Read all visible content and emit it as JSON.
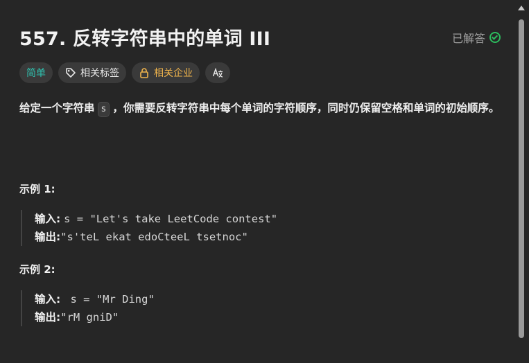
{
  "problem": {
    "title": "557. 反转字符串中的单词 III",
    "status": "已解答"
  },
  "tags": {
    "difficulty": "简单",
    "related_topics": "相关标签",
    "companies": "相关企业",
    "font_toggle": "A文"
  },
  "description": {
    "part1": "给定一个字符串",
    "code": "s",
    "part2": "，你需要反转字符串中每个单词的字符顺序，同时仍保留空格和单词的初始顺序。"
  },
  "examples": [
    {
      "title": "示例 1:",
      "input_label": "输入:",
      "input_value": "s = \"Let's take LeetCode contest\"",
      "output_label": "输出:",
      "output_value": "\"s'teL ekat edoCteeL tsetnoc\""
    },
    {
      "title": "示例 2:",
      "input_label": "输入:",
      "input_value": " s = \"Mr Ding\"",
      "output_label": "输出:",
      "output_value": "\"rM gniD\""
    }
  ],
  "colors": {
    "background": "#262626",
    "easy": "#2fc4b2",
    "company": "#f0b44c",
    "solved_check": "#2cbb5d"
  },
  "icons": [
    "tag-icon",
    "lock-icon",
    "translate-icon",
    "check-circle-icon"
  ]
}
